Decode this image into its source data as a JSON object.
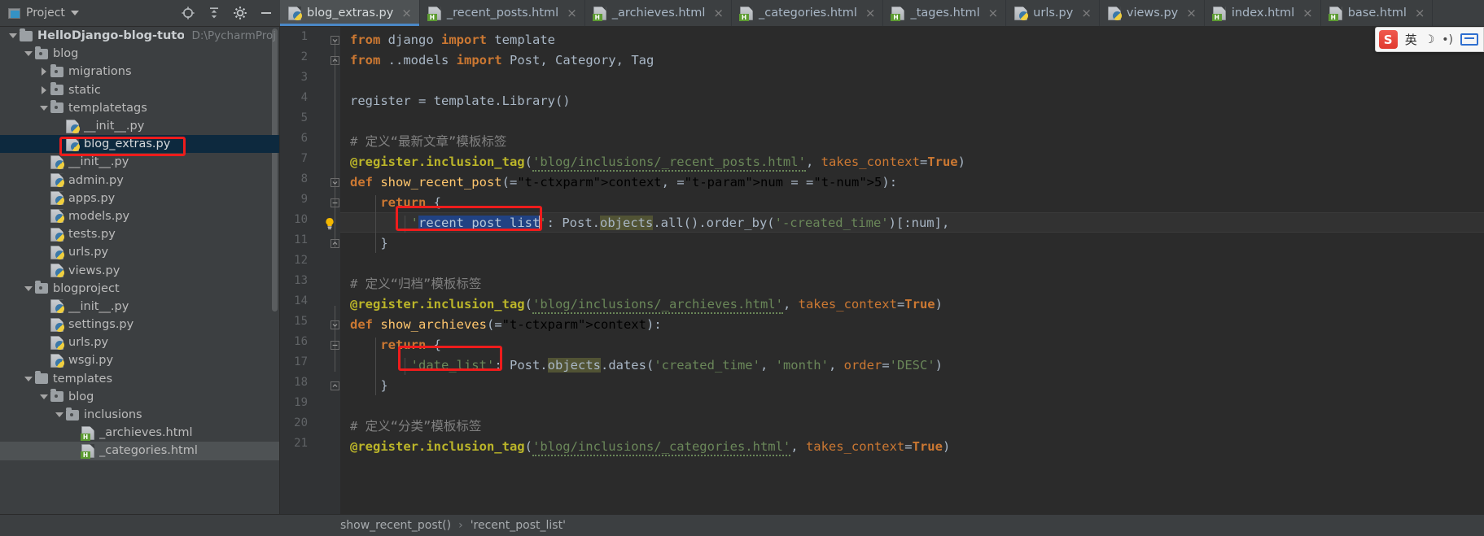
{
  "window": {
    "project_panel": {
      "title": "Project",
      "caret_icon": "chevron-down-icon",
      "actions": [
        {
          "name": "locate-icon",
          "tooltip": "Select Opened File"
        },
        {
          "name": "collapse-all-icon",
          "tooltip": "Collapse All"
        },
        {
          "name": "gear-icon",
          "tooltip": "Settings"
        },
        {
          "name": "minimize-icon",
          "tooltip": "Hide"
        }
      ]
    },
    "tabs": [
      {
        "label": "blog_extras.py",
        "icon": "python-file-icon",
        "active": true,
        "close_icon": "×"
      },
      {
        "label": "_recent_posts.html",
        "icon": "html-file-icon",
        "active": false,
        "close_icon": "×"
      },
      {
        "label": "_archieves.html",
        "icon": "html-file-icon",
        "active": false,
        "close_icon": "×"
      },
      {
        "label": "_categories.html",
        "icon": "html-file-icon",
        "active": false,
        "close_icon": "×"
      },
      {
        "label": "_tages.html",
        "icon": "html-file-icon",
        "active": false,
        "close_icon": "×"
      },
      {
        "label": "urls.py",
        "icon": "python-file-icon",
        "active": false,
        "close_icon": "×"
      },
      {
        "label": "views.py",
        "icon": "python-file-icon",
        "active": false,
        "close_icon": "×"
      },
      {
        "label": "index.html",
        "icon": "html-file-icon",
        "active": false,
        "close_icon": "×"
      },
      {
        "label": "base.html",
        "icon": "html-file-icon",
        "active": false,
        "close_icon": "×"
      }
    ],
    "ime": {
      "logo_text": "S",
      "mode_label": "英",
      "moon_icon": "☽",
      "mic_icon": "•)",
      "keyboard_icon": "keyboard-icon"
    }
  },
  "tree": [
    {
      "indent": 0,
      "twisty": "open",
      "icon": "folder-icon",
      "label": "HelloDjango-blog-tutorial-fxd",
      "bold": true,
      "path": "D:\\PycharmProj",
      "state": "normal"
    },
    {
      "indent": 1,
      "twisty": "open",
      "icon": "folder-module-icon",
      "label": "blog",
      "bold": false,
      "path": "",
      "state": "normal"
    },
    {
      "indent": 2,
      "twisty": "closed",
      "icon": "folder-module-icon",
      "label": "migrations",
      "bold": false,
      "path": "",
      "state": "normal"
    },
    {
      "indent": 2,
      "twisty": "closed",
      "icon": "folder-module-icon",
      "label": "static",
      "bold": false,
      "path": "",
      "state": "normal"
    },
    {
      "indent": 2,
      "twisty": "open",
      "icon": "folder-module-icon",
      "label": "templatetags",
      "bold": false,
      "path": "",
      "state": "normal"
    },
    {
      "indent": 3,
      "twisty": "none",
      "icon": "python-file-icon",
      "label": "__init__.py",
      "bold": false,
      "path": "",
      "state": "normal"
    },
    {
      "indent": 3,
      "twisty": "none",
      "icon": "python-file-icon",
      "label": "blog_extras.py",
      "bold": false,
      "path": "",
      "state": "selected"
    },
    {
      "indent": 2,
      "twisty": "none",
      "icon": "python-file-icon",
      "label": "__init__.py",
      "bold": false,
      "path": "",
      "state": "normal"
    },
    {
      "indent": 2,
      "twisty": "none",
      "icon": "python-file-icon",
      "label": "admin.py",
      "bold": false,
      "path": "",
      "state": "normal"
    },
    {
      "indent": 2,
      "twisty": "none",
      "icon": "python-file-icon",
      "label": "apps.py",
      "bold": false,
      "path": "",
      "state": "normal"
    },
    {
      "indent": 2,
      "twisty": "none",
      "icon": "python-file-icon",
      "label": "models.py",
      "bold": false,
      "path": "",
      "state": "normal"
    },
    {
      "indent": 2,
      "twisty": "none",
      "icon": "python-file-icon",
      "label": "tests.py",
      "bold": false,
      "path": "",
      "state": "normal"
    },
    {
      "indent": 2,
      "twisty": "none",
      "icon": "python-file-icon",
      "label": "urls.py",
      "bold": false,
      "path": "",
      "state": "normal"
    },
    {
      "indent": 2,
      "twisty": "none",
      "icon": "python-file-icon",
      "label": "views.py",
      "bold": false,
      "path": "",
      "state": "normal"
    },
    {
      "indent": 1,
      "twisty": "open",
      "icon": "folder-module-icon",
      "label": "blogproject",
      "bold": false,
      "path": "",
      "state": "normal"
    },
    {
      "indent": 2,
      "twisty": "none",
      "icon": "python-file-icon",
      "label": "__init__.py",
      "bold": false,
      "path": "",
      "state": "normal"
    },
    {
      "indent": 2,
      "twisty": "none",
      "icon": "python-file-icon",
      "label": "settings.py",
      "bold": false,
      "path": "",
      "state": "normal"
    },
    {
      "indent": 2,
      "twisty": "none",
      "icon": "python-file-icon",
      "label": "urls.py",
      "bold": false,
      "path": "",
      "state": "normal"
    },
    {
      "indent": 2,
      "twisty": "none",
      "icon": "python-file-icon",
      "label": "wsgi.py",
      "bold": false,
      "path": "",
      "state": "normal"
    },
    {
      "indent": 1,
      "twisty": "open",
      "icon": "folder-icon",
      "label": "templates",
      "bold": false,
      "path": "",
      "state": "normal"
    },
    {
      "indent": 2,
      "twisty": "open",
      "icon": "folder-module-icon",
      "label": "blog",
      "bold": false,
      "path": "",
      "state": "normal"
    },
    {
      "indent": 3,
      "twisty": "open",
      "icon": "folder-module-icon",
      "label": "inclusions",
      "bold": false,
      "path": "",
      "state": "normal"
    },
    {
      "indent": 4,
      "twisty": "none",
      "icon": "html-file-icon",
      "label": "_archieves.html",
      "bold": false,
      "path": "",
      "state": "normal"
    },
    {
      "indent": 4,
      "twisty": "none",
      "icon": "html-file-icon",
      "label": "_categories.html",
      "bold": false,
      "path": "",
      "state": "hover"
    }
  ],
  "editor": {
    "language": "python",
    "file": "blog_extras.py",
    "caret_line": 10,
    "selection": "recent_post_list",
    "lines": [
      {
        "n": 1,
        "text": "from django import template"
      },
      {
        "n": 2,
        "text": "from ..models import Post, Category, Tag"
      },
      {
        "n": 3,
        "text": ""
      },
      {
        "n": 4,
        "text": "register = template.Library()"
      },
      {
        "n": 5,
        "text": ""
      },
      {
        "n": 6,
        "text": "# 定义“最新文章”模板标签"
      },
      {
        "n": 7,
        "text": "@register.inclusion_tag('blog/inclusions/_recent_posts.html', takes_context=True)"
      },
      {
        "n": 8,
        "text": "def show_recent_post(context, num = 5):"
      },
      {
        "n": 9,
        "text": "    return {"
      },
      {
        "n": 10,
        "text": "        'recent_post_list': Post.objects.all().order_by('-created_time')[:num],"
      },
      {
        "n": 11,
        "text": "    }"
      },
      {
        "n": 12,
        "text": ""
      },
      {
        "n": 13,
        "text": "# 定义“归档”模板标签"
      },
      {
        "n": 14,
        "text": "@register.inclusion_tag('blog/inclusions/_archieves.html', takes_context=True)"
      },
      {
        "n": 15,
        "text": "def show_archieves(context):"
      },
      {
        "n": 16,
        "text": "    return {"
      },
      {
        "n": 17,
        "text": "        'date_list': Post.objects.dates('created_time', 'month', order='DESC')"
      },
      {
        "n": 18,
        "text": "    }"
      },
      {
        "n": 19,
        "text": ""
      },
      {
        "n": 20,
        "text": "# 定义“分类”模板标签"
      },
      {
        "n": 21,
        "text": "@register.inclusion_tag('blog/inclusions/_categories.html', takes_context=True)"
      }
    ],
    "gutter_icons": [
      {
        "line": 10,
        "icon": "lightbulb-icon"
      }
    ]
  },
  "breadcrumb": {
    "items": [
      {
        "label": "show_recent_post()"
      },
      {
        "label": "'recent_post_list'"
      }
    ],
    "separator": "›"
  },
  "annotations": {
    "boxes": [
      {
        "name": "highlight-box-tree-blog-extras"
      },
      {
        "name": "highlight-box-recent-post-list"
      },
      {
        "name": "highlight-box-date-list"
      }
    ],
    "color": "#ee1c1c"
  },
  "colors": {
    "accent": "#4a88c7",
    "panel_bg": "#3c3f41",
    "editor_bg": "#2b2b2b",
    "gutter_bg": "#313335",
    "selection": "#214283",
    "tree_selection": "#0d293e",
    "annotation": "#ee1c1c",
    "keyword": "#cc7832",
    "string": "#6a8759",
    "number": "#6897bb",
    "comment": "#808080",
    "decorator": "#bbb529",
    "function": "#ffc66d",
    "identifier": "#a9b7c6"
  }
}
